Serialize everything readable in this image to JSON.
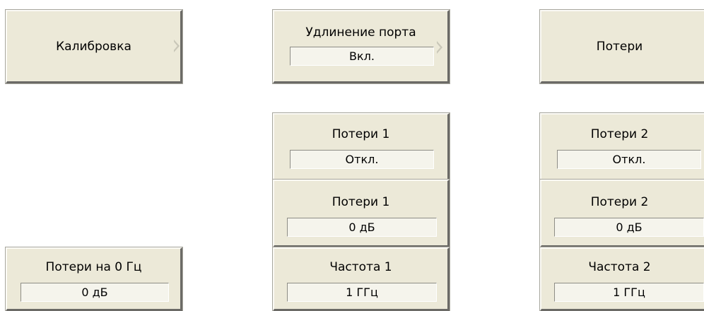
{
  "calibration": {
    "label": "Калибровка"
  },
  "port_extension": {
    "label": "Удлинение порта",
    "value": "Вкл."
  },
  "loss": {
    "label": "Потери"
  },
  "loss1_state": {
    "label": "Потери 1",
    "value": "Откл."
  },
  "loss1_value": {
    "label": "Потери 1",
    "value": "0 дБ"
  },
  "freq1": {
    "label": "Частота 1",
    "value": "1 ГГц"
  },
  "loss2_state": {
    "label": "Потери 2",
    "value": "Откл."
  },
  "loss2_value": {
    "label": "Потери 2",
    "value": "0 дБ"
  },
  "freq2": {
    "label": "Частота 2",
    "value": "1 ГГц"
  },
  "loss_0hz": {
    "label": "Потери на 0 Гц",
    "value": "0 дБ"
  }
}
